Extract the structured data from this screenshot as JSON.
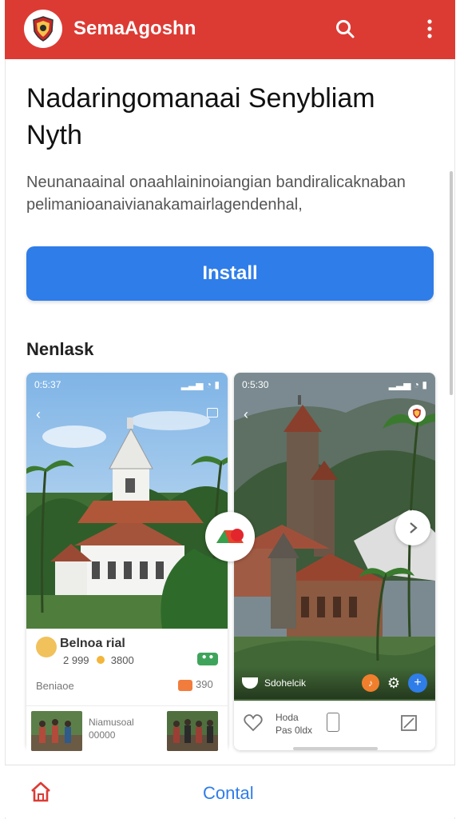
{
  "app": {
    "name": "SemaAgoshn",
    "colors": {
      "header": "#dc3b34",
      "accent": "#2f7de8"
    },
    "icons": {
      "logo": "shield-logo-icon",
      "search": "search-icon",
      "menu": "more-vert-icon"
    }
  },
  "header": {
    "title": "Nadaringomanaai Senybliam Nyth",
    "description": "Neunanaainal onaahlaininoiangian bandiralicaknaban pelimanioanaivianakamairlagendenhal,"
  },
  "install_label": "Install",
  "section_title": "Nenlask",
  "cards": [
    {
      "status_time": "0:5:37",
      "place_name": "Belnoa rial",
      "rating_text": "2 999",
      "rating_value": "3800",
      "footer_label": "Beniaoe",
      "footer_value": "390",
      "thumb_label_1": "Niamusoal",
      "thumb_label_2": "00000"
    },
    {
      "status_time": "0:5:30",
      "overlay_text": "Sdohelcik",
      "action_label_1": "Hoda",
      "action_label_2": "Pas 0ldx"
    }
  ],
  "bottom_nav": {
    "home_icon": "home-icon",
    "contact_label": "Contal"
  }
}
